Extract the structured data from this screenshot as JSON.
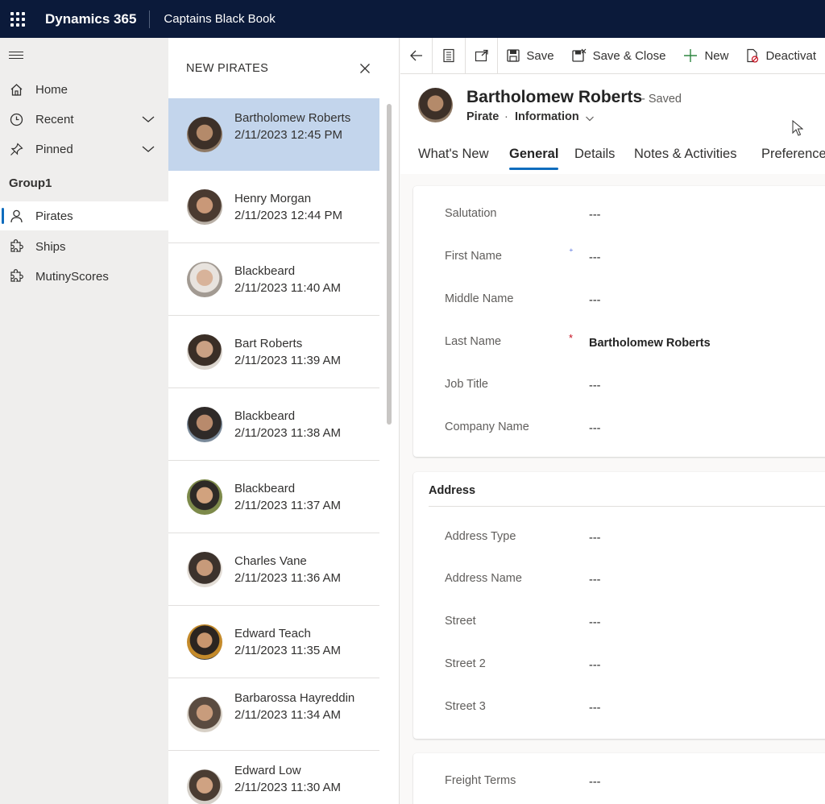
{
  "topbar": {
    "brand": "Dynamics 365",
    "app_name": "Captains Black Book"
  },
  "nav": {
    "items": [
      {
        "label": "Home",
        "icon": "home-icon"
      },
      {
        "label": "Recent",
        "icon": "clock-icon"
      },
      {
        "label": "Pinned",
        "icon": "pin-icon"
      }
    ],
    "group": "Group1",
    "entities": [
      {
        "label": "Pirates",
        "icon": "person-icon",
        "selected": true
      },
      {
        "label": "Ships",
        "icon": "puzzle-icon"
      },
      {
        "label": "MutinyScores",
        "icon": "puzzle-icon"
      }
    ]
  },
  "list": {
    "title": "NEW PIRATES",
    "items": [
      {
        "name": "Bartholomew Roberts",
        "date": "2/11/2023 12:45 PM",
        "selected": true
      },
      {
        "name": "Henry Morgan",
        "date": "2/11/2023 12:44 PM"
      },
      {
        "name": "Blackbeard",
        "date": "2/11/2023 11:40 AM"
      },
      {
        "name": "Bart Roberts",
        "date": "2/11/2023 11:39 AM"
      },
      {
        "name": "Blackbeard",
        "date": "2/11/2023 11:38 AM"
      },
      {
        "name": "Blackbeard",
        "date": "2/11/2023 11:37 AM"
      },
      {
        "name": "Charles Vane",
        "date": "2/11/2023 11:36 AM"
      },
      {
        "name": "Edward Teach",
        "date": "2/11/2023 11:35 AM"
      },
      {
        "name": "Barbarossa Hayreddin",
        "date": "2/11/2023 11:34 AM"
      },
      {
        "name": "Edward Low",
        "date": "2/11/2023 11:30 AM"
      }
    ]
  },
  "commands": {
    "save": "Save",
    "save_close": "Save & Close",
    "new": "New",
    "deactivate": "Deactivat"
  },
  "record": {
    "title": "Bartholomew Roberts",
    "status": "- Saved",
    "entity": "Pirate",
    "separator": "·",
    "form": "Information"
  },
  "tabs": [
    "What's New",
    "General",
    "Details",
    "Notes & Activities",
    "Preference"
  ],
  "active_tab": "General",
  "general": {
    "fields": [
      {
        "label": "Salutation",
        "value": "---"
      },
      {
        "label": "First Name",
        "value": "---",
        "required": "recommended"
      },
      {
        "label": "Middle Name",
        "value": "---"
      },
      {
        "label": "Last Name",
        "value": "Bartholomew Roberts",
        "required": "required"
      },
      {
        "label": "Job Title",
        "value": "---"
      },
      {
        "label": "Company Name",
        "value": "---"
      }
    ]
  },
  "address": {
    "title": "Address",
    "fields": [
      {
        "label": "Address Type",
        "value": "---"
      },
      {
        "label": "Address Name",
        "value": "---"
      },
      {
        "label": "Street",
        "value": "---"
      },
      {
        "label": "Street 2",
        "value": "---"
      },
      {
        "label": "Street 3",
        "value": "---"
      }
    ]
  },
  "shipping": {
    "fields": [
      {
        "label": "Freight Terms",
        "value": "---"
      }
    ]
  },
  "colors": {
    "topbar": "#0b1a3a",
    "accent": "#0f6cbd",
    "selected_row": "#c3d5ec",
    "required": "#c50f1f",
    "recommended": "#3a5bd9"
  }
}
